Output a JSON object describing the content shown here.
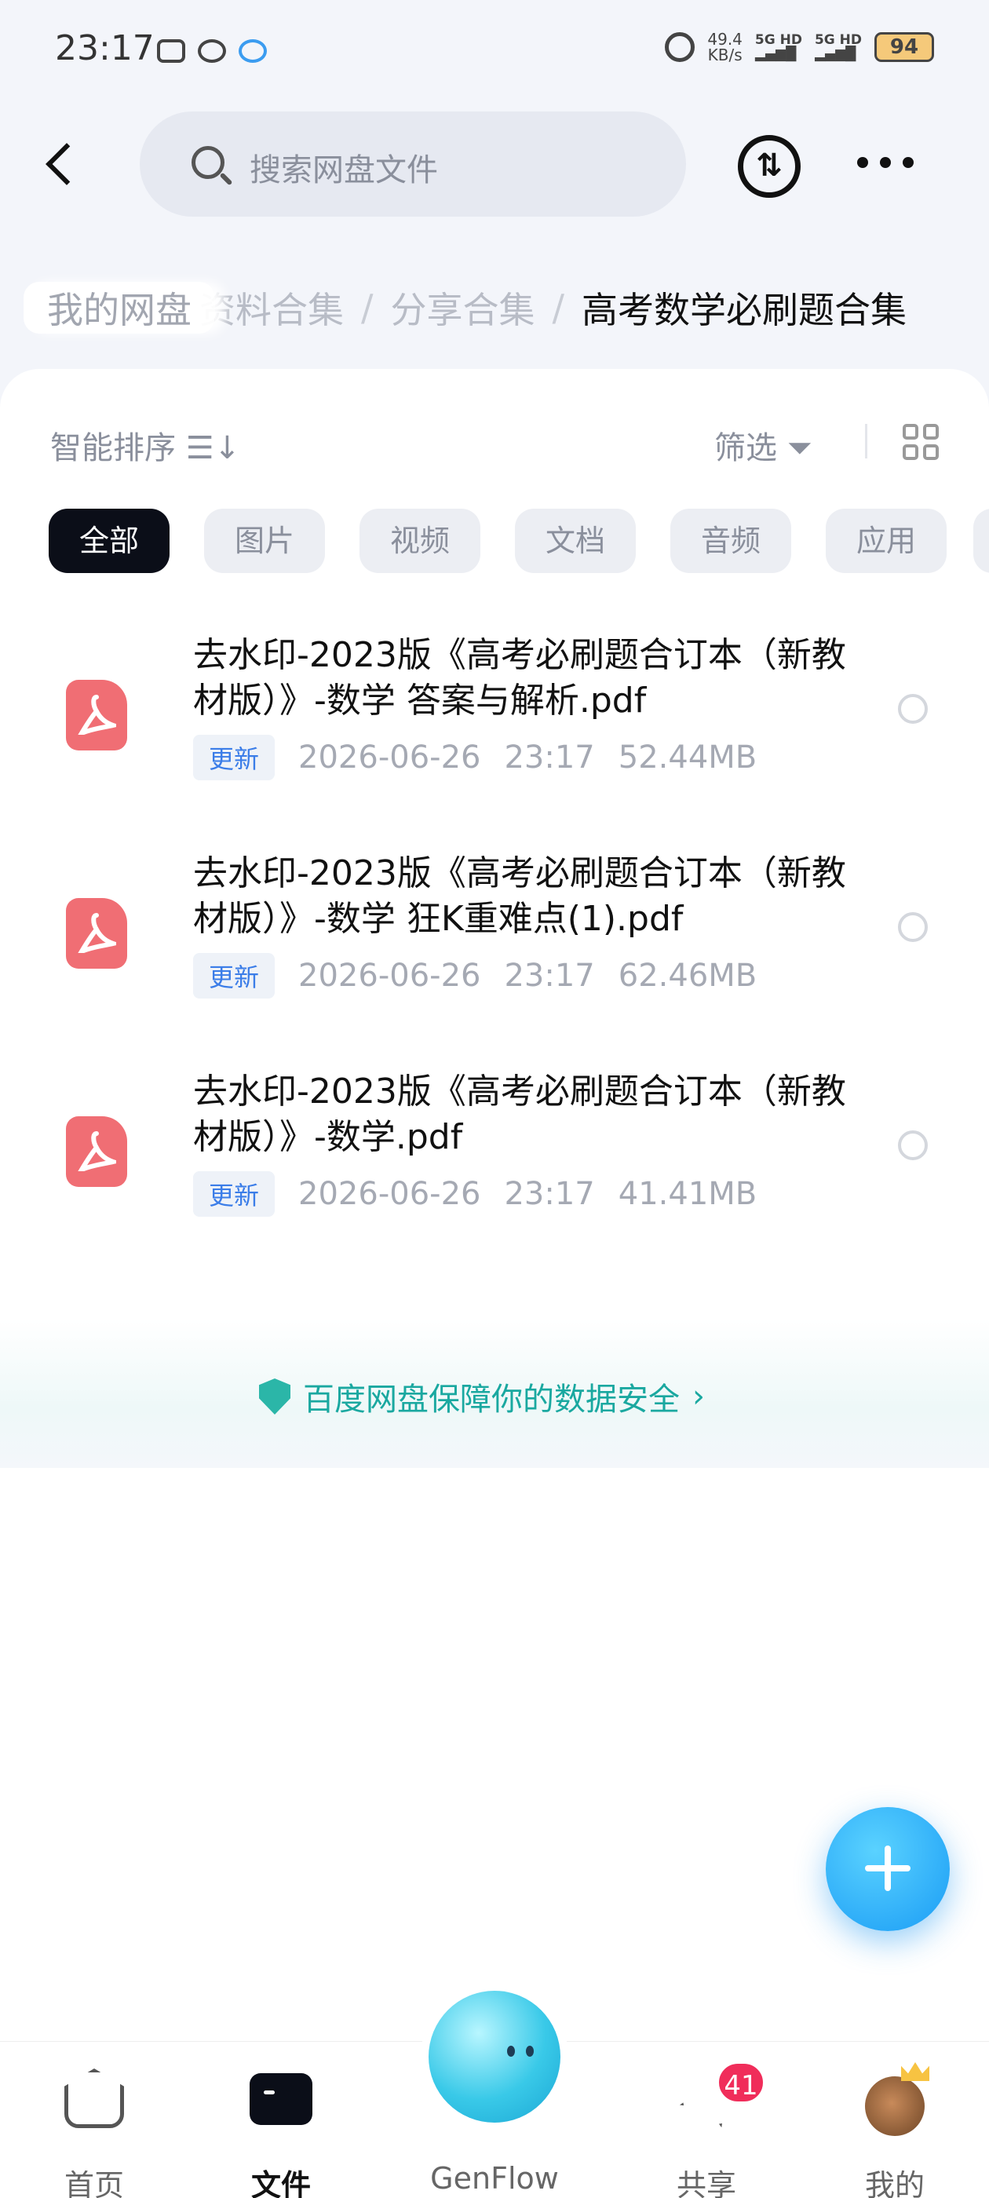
{
  "status_bar": {
    "time": "23:17",
    "net_speed_value": "49.4",
    "net_speed_unit": "KB/s",
    "signal_1": "5G HD",
    "signal_2": "5G HD",
    "battery": "94"
  },
  "header": {
    "search_placeholder": "搜索网盘文件",
    "transfer_icon": "transfer-icon",
    "more_icon": "more-icon"
  },
  "breadcrumb": {
    "home": "我的网盘",
    "items": [
      "资料合集",
      "分享合集"
    ],
    "separator": "/",
    "current": "高考数学必刷题合集"
  },
  "toolbar": {
    "sort_label": "智能排序 ☰↓",
    "filter_label": "筛选"
  },
  "tabs": [
    "全部",
    "图片",
    "视频",
    "文档",
    "音频",
    "应用"
  ],
  "files": [
    {
      "name": "去水印-2023版《高考必刷题合订本（新教材版）》-数学 答案与解析.pdf",
      "badge": "更新",
      "date": "2026-06-26",
      "time": "23:17",
      "size": "52.44MB"
    },
    {
      "name": "去水印-2023版《高考必刷题合订本（新教材版）》-数学 狂K重难点(1).pdf",
      "badge": "更新",
      "date": "2026-06-26",
      "time": "23:17",
      "size": "62.46MB"
    },
    {
      "name": "去水印-2023版《高考必刷题合订本（新教材版）》-数学.pdf",
      "badge": "更新",
      "date": "2026-06-26",
      "time": "23:17",
      "size": "41.41MB"
    }
  ],
  "security_notice": "百度网盘保障你的数据安全",
  "bottom_nav": {
    "home": "首页",
    "files": "文件",
    "genflow": "GenFlow",
    "share": "共享",
    "share_badge": "41",
    "me": "我的"
  },
  "colors": {
    "accent": "#1a9cf5",
    "pdf": "#f06e74",
    "security": "#1aa8a0",
    "badge_red": "#f02d5a"
  }
}
